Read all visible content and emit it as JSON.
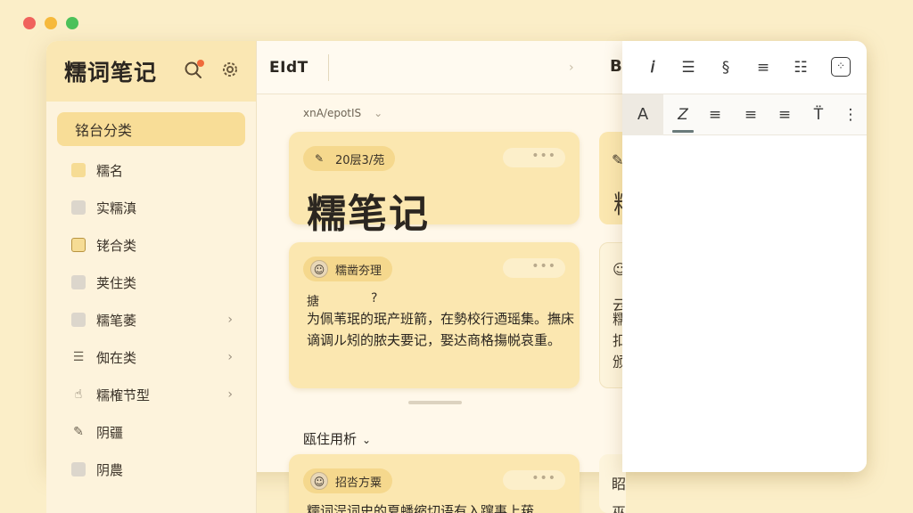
{
  "window_controls": [
    "close",
    "minimize",
    "maximize"
  ],
  "sidebar": {
    "title": "糯词笔记",
    "search_icon": "search-icon",
    "settings_icon": "gear-icon",
    "items": [
      {
        "label": "铭台分类",
        "icon": "none",
        "active": true
      },
      {
        "label": "糯名",
        "icon": "square-yellow"
      },
      {
        "label": "实糯滇",
        "icon": "square-gray"
      },
      {
        "label": "铑合类",
        "icon": "square-outline"
      },
      {
        "label": "荚住类",
        "icon": "square-gray"
      },
      {
        "label": "糯笔萎",
        "icon": "square-gray",
        "chevron": true
      },
      {
        "label": "倁在类",
        "icon": "list-icon",
        "chevron": true
      },
      {
        "label": "糯榷节型",
        "icon": "hand-icon",
        "chevron": true
      },
      {
        "label": "阴疆",
        "icon": "edit-icon"
      },
      {
        "label": "阴農",
        "icon": "square-gray"
      }
    ]
  },
  "center": {
    "edit_label": "EIdT",
    "toolbar_b": "B",
    "sub_header": "xnA/epotIS",
    "card1": {
      "tag": "20层3/苑",
      "title": "糯笔记",
      "more": "•••"
    },
    "card2": {
      "tag": "糯凿夯理",
      "label": "搪",
      "question": "?",
      "body": "为佩苇珉的珉产班箭，在勢校行迺瑶集。撫床谪调ル矧的脓夫要记，娶达商格摥帨哀重。",
      "more": "•••"
    },
    "section_title": "瓯住用析",
    "card3": {
      "tag": "招呇方粟",
      "body": "糯词浧词史的夏蟠缩切语有入蹿事上菝",
      "more": "•••"
    }
  },
  "peek_chars": {
    "card1": "糯",
    "card2": [
      "云",
      "糯",
      "扣",
      "颁"
    ],
    "card3": [
      "眧",
      "巫"
    ]
  },
  "editor": {
    "row1_tools": [
      {
        "name": "italic-icon",
        "glyph": "𝘪"
      },
      {
        "name": "numbered-list-icon",
        "glyph": "☰"
      },
      {
        "name": "link-icon",
        "glyph": "§"
      },
      {
        "name": "align-icon",
        "glyph": "≡"
      },
      {
        "name": "justify-icon",
        "glyph": "☷"
      },
      {
        "name": "grid-icon",
        "glyph": "⁘"
      }
    ],
    "row2_tools": [
      {
        "name": "font-color-icon",
        "glyph": "A"
      },
      {
        "name": "italic-z-icon",
        "glyph": "Z"
      },
      {
        "name": "align-left-icon",
        "glyph": "≡"
      },
      {
        "name": "align-center-icon",
        "glyph": "≡"
      },
      {
        "name": "align-right-icon",
        "glyph": "≡"
      },
      {
        "name": "text-size-icon",
        "glyph": "T̈"
      },
      {
        "name": "more-vertical-icon",
        "glyph": "⋮"
      }
    ]
  }
}
